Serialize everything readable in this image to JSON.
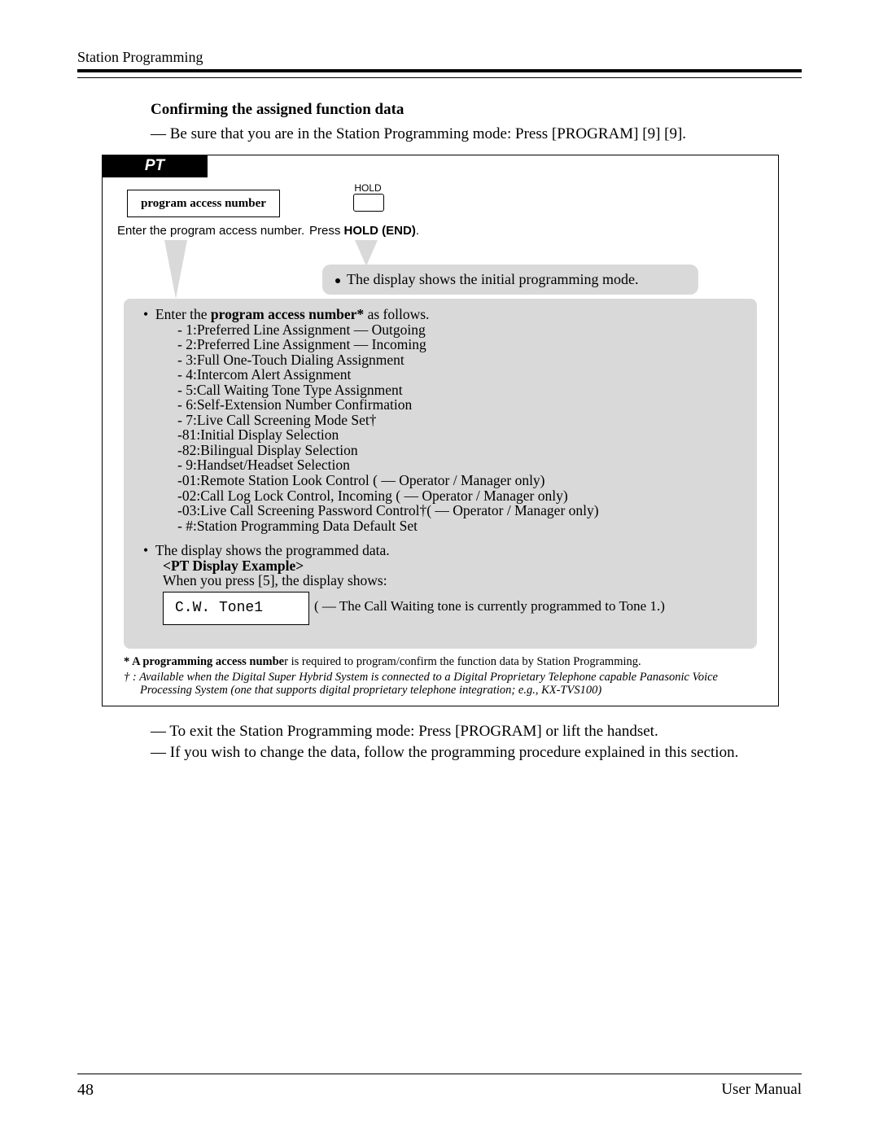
{
  "header": {
    "section": "Station Programming"
  },
  "title": "Confirming the assigned function data",
  "intro": "— Be sure that you are in the Station Programming mode: Press [PROGRAM] [9] [9].",
  "pt_label": "PT",
  "step1": {
    "box": "program access number",
    "caption_pre": "Enter the program access number."
  },
  "step2": {
    "btn_label": "HOLD",
    "caption_pre": "Press ",
    "caption_bold": "HOLD (END)",
    "caption_post": "."
  },
  "callout_small": "The display shows the initial programming mode.",
  "big": {
    "lead_pre": "Enter the ",
    "lead_bold": "program access number*",
    "lead_post": " as follows.",
    "items": [
      "-  1:Preferred Line Assignment  —  Outgoing",
      "-  2:Preferred Line Assignment  —  Incoming",
      "-  3:Full One-Touch Dialing Assignment",
      "-  4:Intercom Alert Assignment",
      "-  5:Call Waiting Tone Type Assignment",
      "-  6:Self-Extension Number Confirmation",
      "-  7:Live Call Screening Mode Set†",
      "-81:Initial Display Selection",
      "-82:Bilingual Display Selection",
      "-  9:Handset/Headset Selection",
      "-01:Remote Station Look Control ( —  Operator / Manager only)",
      "-02:Call Log Lock Control, Incoming ( — Operator / Manager only)",
      "-03:Live Call Screening Password Control†( —  Operator / Manager only)",
      "-  #:Station Programming Data Default Set"
    ],
    "disp_lead": "The display shows the programmed data.",
    "disp_title": "<PT Display Example>",
    "disp_when": "When you press [5], the display shows:",
    "disp_value": "C.W. Tone1",
    "disp_ann": "( —  The Call Waiting tone is currently programmed to Tone 1.)"
  },
  "footnotes": {
    "f1_bold": "* A programming access numbe",
    "f1_rest": "r is required to program/confirm the function data by Station Programming.",
    "f2": "† : Available when the Digital Super Hybrid System is connected to a Digital Proprietary Telephone capable Panasonic Voice Processing System (one that supports digital proprietary telephone integration; e.g., KX-TVS100)"
  },
  "after": [
    "— To exit the Station Programming mode: Press [PROGRAM] or lift the handset.",
    "— If you wish to change the data, follow the programming procedure explained in this section."
  ],
  "footer": {
    "page": "48",
    "doc": "User Manual"
  }
}
